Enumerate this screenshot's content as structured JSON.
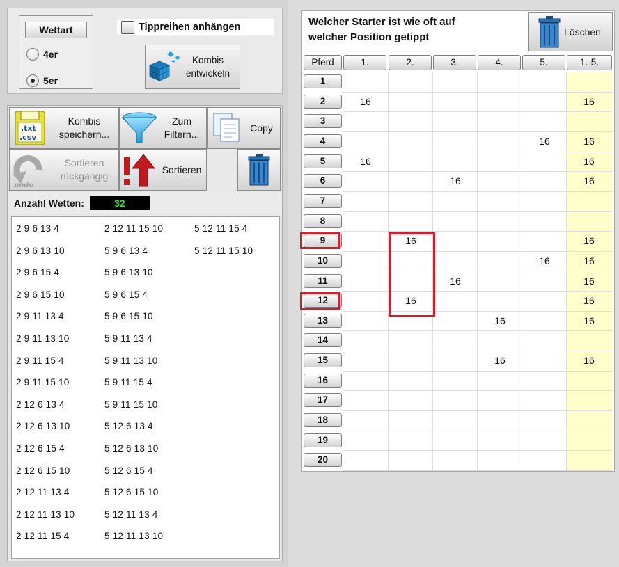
{
  "wettart": {
    "title": "Wettart",
    "options": [
      {
        "label": "4er",
        "selected": false
      },
      {
        "label": "5er",
        "selected": true
      }
    ]
  },
  "tippreihen": {
    "label": "Tippreihen anhängen",
    "checked": false
  },
  "kombis_entwickeln": {
    "line1": "Kombis",
    "line2": "entwickeln"
  },
  "toolbar": {
    "kombis_speichern": {
      "line1": "Kombis",
      "line2": "speichern..."
    },
    "zum_filtern": {
      "line1": "Zum",
      "line2": "Filtern..."
    },
    "copy": "Copy",
    "sortieren_rueckgaengig": {
      "line1": "Sortieren",
      "line2": "rückgängig",
      "enabled": false
    },
    "sortieren": "Sortieren",
    "txt_label": ".txt",
    "csv_label": ".csv",
    "undo_label": "undo"
  },
  "anzahl_wetten": {
    "label": "Anzahl Wetten:",
    "value": "32"
  },
  "bets": {
    "col1": [
      "2 9 6 13 4",
      "2 9 6 13 10",
      "2 9 6 15 4",
      "2 9 6 15 10",
      "2 9 11 13 4",
      "2 9 11 13 10",
      "2 9 11 15 4",
      "2 9 11 15 10",
      "2 12 6 13 4",
      "2 12 6 13 10",
      "2 12 6 15 4",
      "2 12 6 15 10",
      "2 12 11 13 4",
      "2 12 11 13 10",
      "2 12 11 15 4"
    ],
    "col2": [
      "2 12 11 15 10",
      "5 9 6 13 4",
      "5 9 6 13 10",
      "5 9 6 15 4",
      "5 9 6 15 10",
      "5 9 11 13 4",
      "5 9 11 13 10",
      "5 9 11 15 4",
      "5 9 11 15 10",
      "5 12 6 13 4",
      "5 12 6 13 10",
      "5 12 6 15 4",
      "5 12 6 15 10",
      "5 12 11 13 4",
      "5 12 11 13 10"
    ],
    "col3": [
      "5 12 11 15 4",
      "5 12 11 15 10"
    ]
  },
  "grid": {
    "title_line1": "Welcher Starter ist wie oft auf",
    "title_line2": "welcher Position getippt",
    "loeschen": "Löschen",
    "headers": [
      "Pferd",
      "1.",
      "2.",
      "3.",
      "4.",
      "5.",
      "1.-5."
    ],
    "rows": [
      {
        "pferd": "1",
        "c": [
          "",
          "",
          "",
          "",
          "",
          ""
        ]
      },
      {
        "pferd": "2",
        "c": [
          "16",
          "",
          "",
          "",
          "",
          "16"
        ]
      },
      {
        "pferd": "3",
        "c": [
          "",
          "",
          "",
          "",
          "",
          ""
        ]
      },
      {
        "pferd": "4",
        "c": [
          "",
          "",
          "",
          "",
          "16",
          "16"
        ]
      },
      {
        "pferd": "5",
        "c": [
          "16",
          "",
          "",
          "",
          "",
          "16"
        ]
      },
      {
        "pferd": "6",
        "c": [
          "",
          "",
          "16",
          "",
          "",
          "16"
        ]
      },
      {
        "pferd": "7",
        "c": [
          "",
          "",
          "",
          "",
          "",
          ""
        ]
      },
      {
        "pferd": "8",
        "c": [
          "",
          "",
          "",
          "",
          "",
          ""
        ]
      },
      {
        "pferd": "9",
        "c": [
          "",
          "16",
          "",
          "",
          "",
          "16"
        ]
      },
      {
        "pferd": "10",
        "c": [
          "",
          "",
          "",
          "",
          "16",
          "16"
        ]
      },
      {
        "pferd": "11",
        "c": [
          "",
          "",
          "16",
          "",
          "",
          "16"
        ]
      },
      {
        "pferd": "12",
        "c": [
          "",
          "16",
          "",
          "",
          "",
          "16"
        ]
      },
      {
        "pferd": "13",
        "c": [
          "",
          "",
          "",
          "16",
          "",
          "16"
        ]
      },
      {
        "pferd": "14",
        "c": [
          "",
          "",
          "",
          "",
          "",
          ""
        ]
      },
      {
        "pferd": "15",
        "c": [
          "",
          "",
          "",
          "16",
          "",
          "16"
        ]
      },
      {
        "pferd": "16",
        "c": [
          "",
          "",
          "",
          "",
          "",
          ""
        ]
      },
      {
        "pferd": "17",
        "c": [
          "",
          "",
          "",
          "",
          "",
          ""
        ]
      },
      {
        "pferd": "18",
        "c": [
          "",
          "",
          "",
          "",
          "",
          ""
        ]
      },
      {
        "pferd": "19",
        "c": [
          "",
          "",
          "",
          "",
          "",
          ""
        ]
      },
      {
        "pferd": "20",
        "c": [
          "",
          "",
          "",
          "",
          "",
          ""
        ]
      }
    ]
  },
  "colors": {
    "highlight": "#d81c2a",
    "sum_column_bg": "#ffffcc",
    "counter_text": "#2ee83b"
  }
}
